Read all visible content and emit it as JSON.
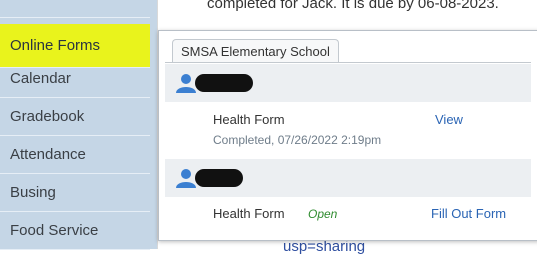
{
  "sidebar": {
    "items": [
      {
        "label": "Online Forms"
      },
      {
        "label": "Calendar"
      },
      {
        "label": "Gradebook"
      },
      {
        "label": "Attendance"
      },
      {
        "label": "Busing"
      },
      {
        "label": "Food Service"
      }
    ]
  },
  "main": {
    "top_text": "completed for Jack. It is due by 06-08-2023.",
    "bottom_text": "usp=sharing"
  },
  "popup": {
    "tab_label": "SMSA Elementary School",
    "students": [
      {
        "forms": [
          {
            "name": "Health Form",
            "status": "Completed, 07/26/2022 2:19pm",
            "action": "View"
          }
        ]
      },
      {
        "forms": [
          {
            "name": "Health Form",
            "status": "Open",
            "action": "Fill Out Form"
          }
        ]
      }
    ]
  },
  "colors": {
    "sidebar_bg": "#c5d6e6",
    "highlight": "#e9f31c",
    "link": "#2a64b4",
    "open_status": "#2e8b2e",
    "user_icon": "#3b7fd1"
  }
}
